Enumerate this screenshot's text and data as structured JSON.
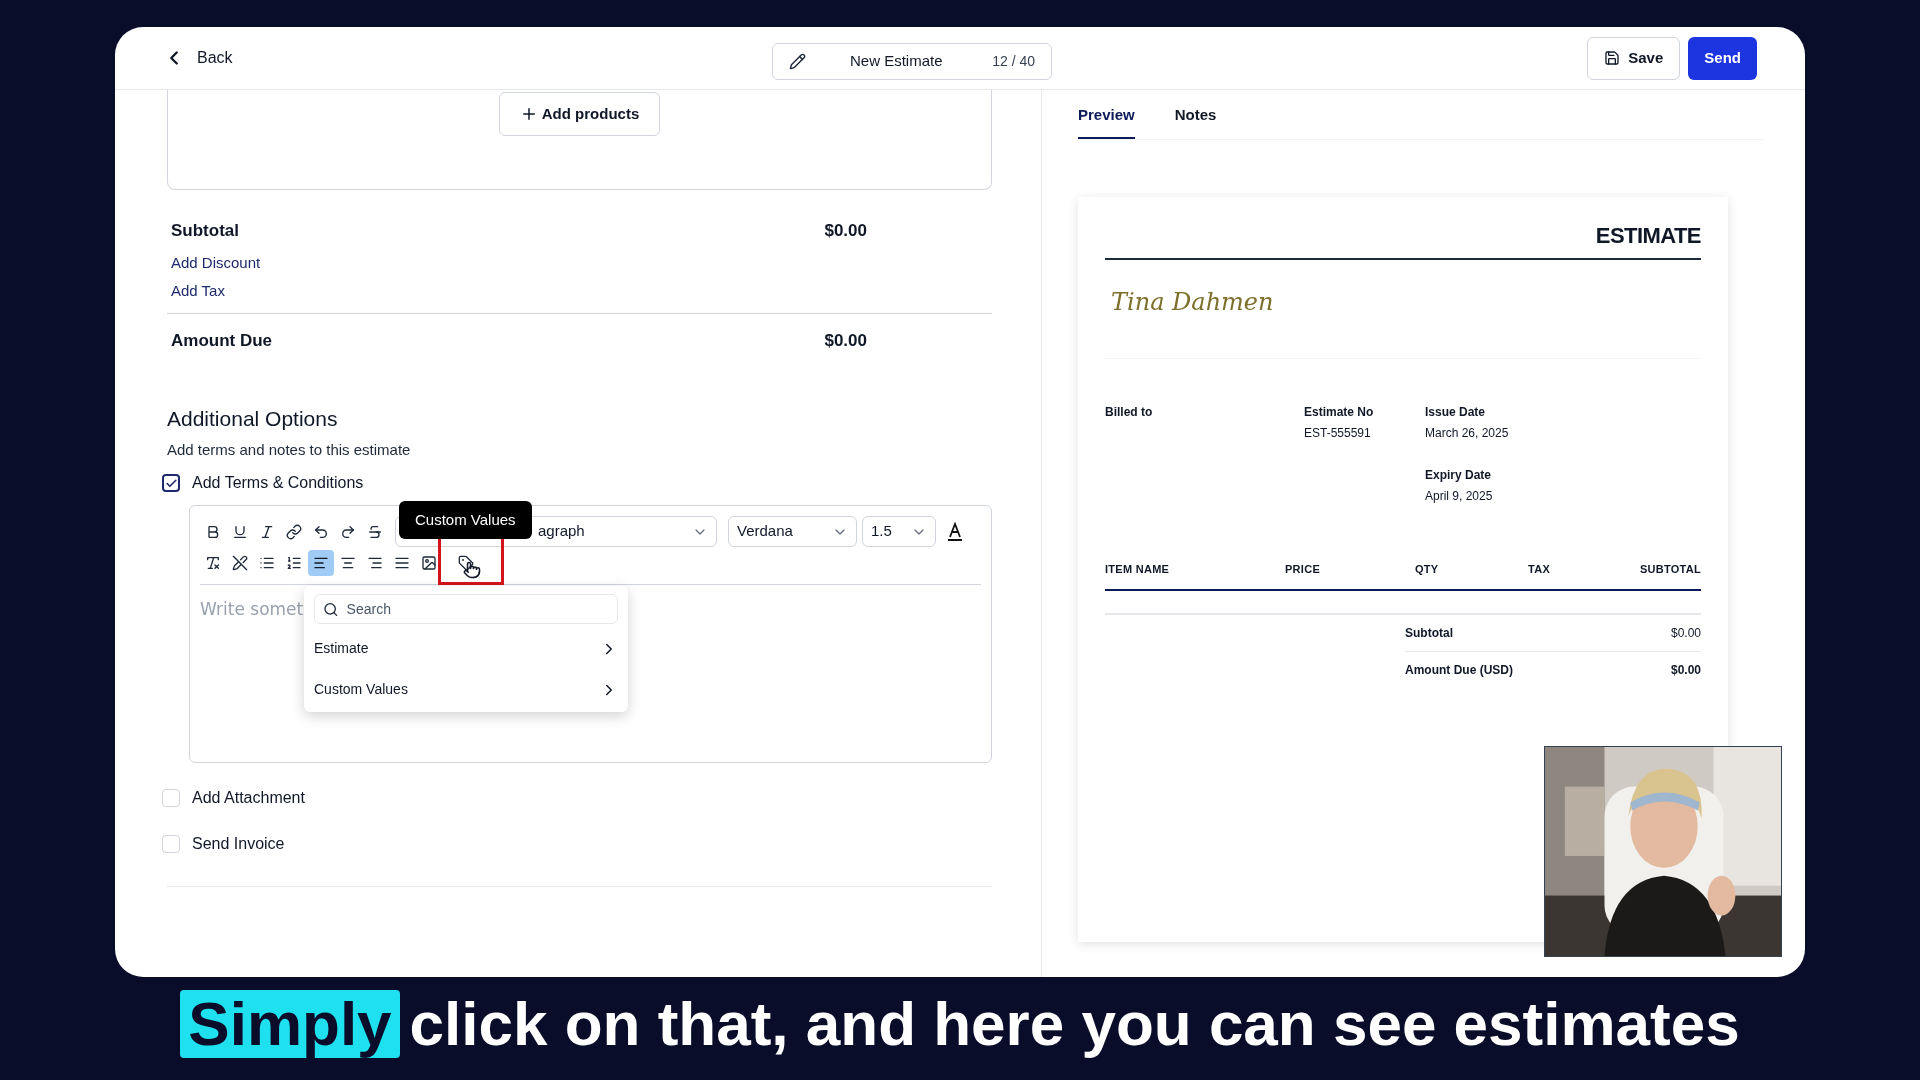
{
  "header": {
    "back": "Back",
    "title": "New Estimate",
    "counter": "12 / 40",
    "save": "Save",
    "send": "Send"
  },
  "products": {
    "add_button": "Add products"
  },
  "summary": {
    "subtotal_label": "Subtotal",
    "subtotal_value": "$0.00",
    "links": [
      "Add Discount",
      "Add Tax"
    ],
    "amount_due_label": "Amount Due",
    "amount_due_value": "$0.00"
  },
  "additional_options": {
    "title": "Additional Options",
    "subtitle": "Add terms and notes to this estimate"
  },
  "terms": {
    "label": "Add Terms & Conditions",
    "checked": true
  },
  "editor": {
    "format_select": "agraph",
    "font_select": "Verdana",
    "line_height_select": "1.5",
    "align_buttons": [
      {
        "selected": true
      },
      {
        "selected": false
      },
      {
        "selected": false
      },
      {
        "selected": false
      }
    ],
    "placeholder": "Write somet",
    "tooltip": "Custom Values",
    "menu": {
      "search_placeholder": "Search",
      "items": [
        "Estimate",
        "Custom Values"
      ]
    }
  },
  "options": [
    {
      "label": "Add Attachment",
      "checked": false
    },
    {
      "label": "Send Invoice",
      "checked": false
    }
  ],
  "tabs": [
    {
      "label": "Preview",
      "selected": true
    },
    {
      "label": "Notes",
      "selected": false
    }
  ],
  "document": {
    "title": "ESTIMATE",
    "logo": "Tina Dahmen",
    "billed_to": "Billed to",
    "estimate_no_label": "Estimate No",
    "estimate_no": "EST-555591",
    "issue_date_label": "Issue Date",
    "issue_date": "March 26, 2025",
    "expiry_date_label": "Expiry Date",
    "expiry_date": "April 9, 2025",
    "columns": [
      "ITEM NAME",
      "PRICE",
      "QTY",
      "TAX",
      "SUBTOTAL"
    ],
    "totals": [
      {
        "label": "Subtotal",
        "value": "$0.00",
        "bold": false
      },
      {
        "label": "Amount Due (USD)",
        "value": "$0.00",
        "bold": true
      }
    ]
  },
  "caption": {
    "highlight": "Simply",
    "text": "click on that, and here you can see estimates"
  }
}
